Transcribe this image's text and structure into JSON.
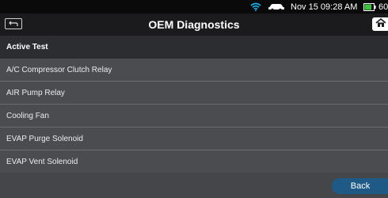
{
  "status_bar": {
    "datetime": "Nov 15 09:28 AM",
    "battery_percent": "60",
    "icons": [
      "wifi-icon",
      "car-icon",
      "battery-icon"
    ],
    "battery_color": "#39c43a"
  },
  "header": {
    "title": "OEM Diagnostics",
    "left_icon": "back-arrow-icon",
    "right_icon": "home-icon"
  },
  "section": {
    "title": "Active Test"
  },
  "items": [
    {
      "label": "A/C Compressor Clutch Relay"
    },
    {
      "label": "AIR Pump Relay"
    },
    {
      "label": "Cooling Fan"
    },
    {
      "label": "EVAP Purge Solenoid"
    },
    {
      "label": "EVAP Vent Solenoid"
    }
  ],
  "footer": {
    "back_label": "Back",
    "accent": "#1f5a86"
  }
}
